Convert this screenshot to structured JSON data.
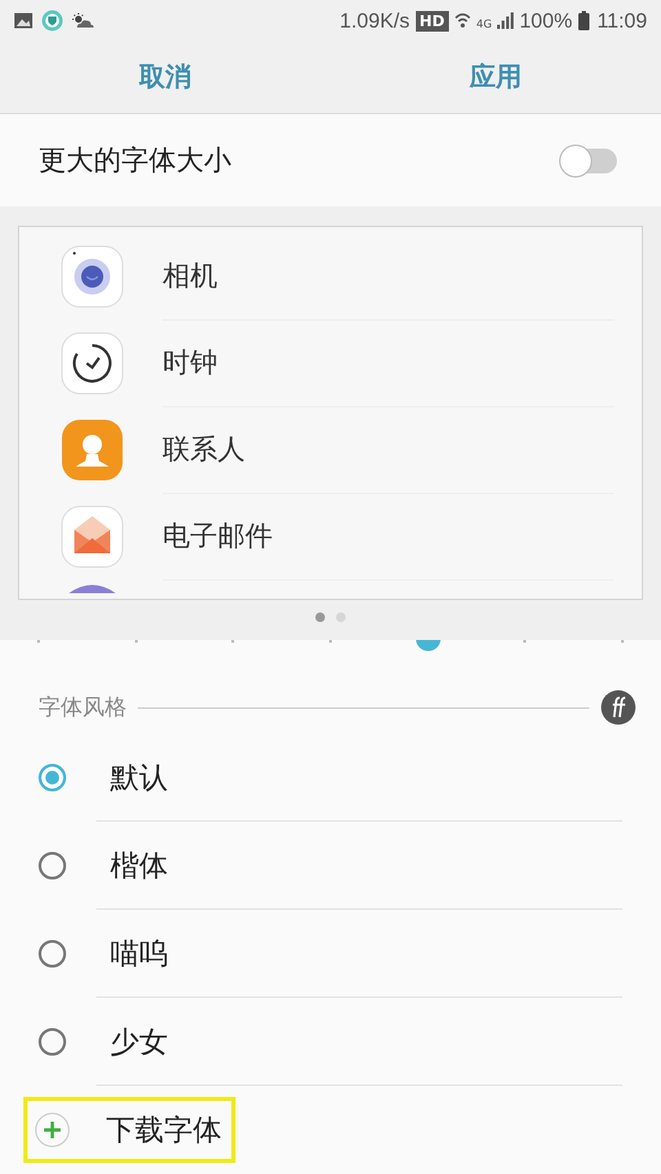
{
  "status_bar": {
    "speed": "1.09K/s",
    "hd": "HD",
    "network": "4G",
    "battery": "100%",
    "time": "11:09"
  },
  "action_bar": {
    "cancel": "取消",
    "apply": "应用"
  },
  "larger_font": {
    "label": "更大的字体大小",
    "on": false
  },
  "preview": {
    "apps": [
      {
        "kind": "camera",
        "label": "相机"
      },
      {
        "kind": "clock",
        "label": "时钟"
      },
      {
        "kind": "contacts",
        "label": "联系人"
      },
      {
        "kind": "email",
        "label": "电子邮件"
      }
    ],
    "pages": [
      {
        "selected": true
      },
      {
        "selected": false
      }
    ]
  },
  "font_size_slider": {
    "level": 0.667
  },
  "font_style": {
    "title": "字体风格",
    "options": [
      {
        "label": "默认",
        "selected": true
      },
      {
        "label": "楷体",
        "selected": false
      },
      {
        "label": "喵呜",
        "selected": false
      },
      {
        "label": "少女",
        "selected": false
      }
    ],
    "download": {
      "label": "下载字体",
      "highlighted": true
    }
  }
}
